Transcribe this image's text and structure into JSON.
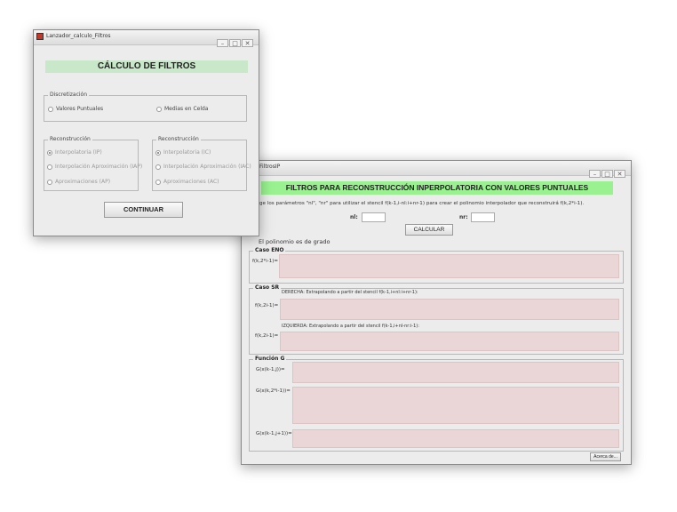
{
  "win1": {
    "title": "Lanzador_calculo_Filtros",
    "heading": "CÁLCULO DE FILTROS",
    "discretizacion": {
      "legend": "Discretización",
      "opt1": "Valores Puntuales",
      "opt2": "Medias en Celda"
    },
    "recon_left": {
      "legend": "Reconstrucción",
      "opt1": "Interpolatoria (IP)",
      "opt2": "Interpolación Aproximación (IAP)",
      "opt3": "Aproximaciones (AP)"
    },
    "recon_right": {
      "legend": "Reconstrucción",
      "opt1": "Interpolatoria (IC)",
      "opt2": "Interpolación Aproximación (IAC)",
      "opt3": "Aproximaciones (AC)"
    },
    "continue_label": "CONTINUAR"
  },
  "win2": {
    "title": "FiltrosIP",
    "heading": "FILTROS PARA RECONSTRUCCIÓN INPERPOLATORIA CON VALORES PUNTUALES",
    "instruction": "ge los parámetros \"nl\", \"nr\" para utilizar el stencil f(k-1,i-nl:i+nr-1) para crear el polinomio interpolador que reconstruirá f(k,2*i-1).",
    "nl_label": "nl:",
    "nr_label": "nr:",
    "calc_label": "CALCULAR",
    "grade_text": "El polinomio es de grado",
    "eno": {
      "legend": "Caso ENO",
      "label": "f(k,2*i-1)="
    },
    "sr": {
      "legend": "Caso SR",
      "derecha": "DERECHA: Extrapolando a partir del stencil f(k-1,i+nl:i+nr-1):",
      "label1": "f(k,2i-1)=",
      "izquierda": "IZQUIERDA: Extrapolando a partir del stencil f(k-1,i+nl-nr:i-1):",
      "label2": "f(k,2i-1)="
    },
    "funcion_g": {
      "legend": "Función G",
      "label1": "G(x(k-1,j))=",
      "label2": "G(x(k,2*i-1))=",
      "label3": "G(x(k-1,j+1))="
    },
    "about_label": "Acerca de..."
  },
  "colors": {
    "banner_green": "#c9e8c9",
    "banner2_green": "#99f28f",
    "output_pink": "#ead6d6",
    "window_bg": "#ececec"
  }
}
